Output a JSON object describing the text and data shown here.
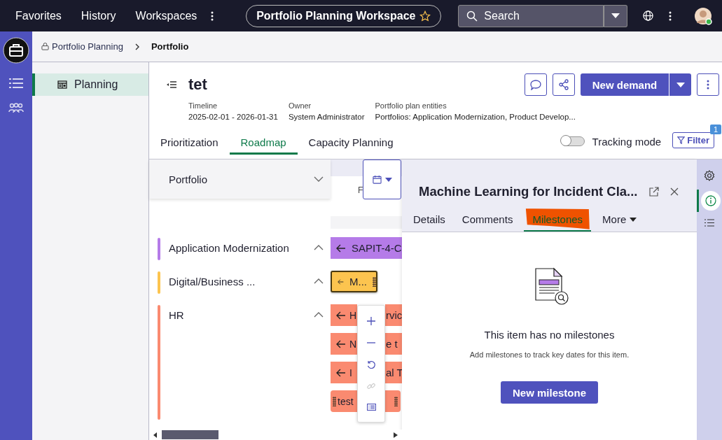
{
  "top_nav": {
    "links": [
      "Favorites",
      "History",
      "Workspaces"
    ],
    "workspace": "Portfolio Planning Workspace",
    "search": {
      "placeholder": "Search"
    }
  },
  "breadcrumb": [
    {
      "label": "Portfolio Planning",
      "kind": "link"
    },
    {
      "label": "Portfolio",
      "kind": "current"
    }
  ],
  "sidebar": {
    "items": [
      {
        "label": "Planning",
        "selected": true
      }
    ]
  },
  "header": {
    "title": "tet",
    "fields": [
      {
        "label": "Timeline",
        "value": "2025-02-01 - 2026-01-31"
      },
      {
        "label": "Owner",
        "value": "System Administrator"
      },
      {
        "label": "Portfolio plan entities",
        "value": "Portfolios: Application Modernization, Product Develop..."
      }
    ],
    "primary_button": "New demand"
  },
  "tabs": [
    {
      "label": "Prioritization",
      "selected": false
    },
    {
      "label": "Roadmap",
      "selected": true
    },
    {
      "label": "Capacity Planning",
      "selected": false
    }
  ],
  "tracking_mode": {
    "label": "Tracking mode",
    "on": false
  },
  "filter": {
    "label": "Filter",
    "badge": "1"
  },
  "portfolio_panel": {
    "title": "Portfolio",
    "groups": [
      {
        "name": "Application Modernization",
        "color": "#b57be8",
        "expanded": true,
        "bars": [
          {
            "kind": "arrow",
            "label": "SAPIT-4-C",
            "selected": false
          }
        ]
      },
      {
        "name": "Digital/Business ...",
        "color": "#fcc44f",
        "expanded": true,
        "bars": [
          {
            "kind": "arrow",
            "label": "M...",
            "selected": true
          }
        ]
      },
      {
        "name": "HR",
        "color": "#fa8a70",
        "expanded": true,
        "bars": [
          {
            "kind": "arrow",
            "label": "H",
            "label_after": "rvic",
            "selected": false
          },
          {
            "kind": "arrow",
            "label": "N",
            "label_after": "e t",
            "selected": false
          },
          {
            "kind": "arrow",
            "label": "I",
            "label_after": "al T",
            "selected": false
          },
          {
            "kind": "plain",
            "label": "test",
            "selected": false
          }
        ]
      }
    ]
  },
  "timeline_header": "F",
  "detail": {
    "title": "Machine Learning for Incident Cla...",
    "tabs": [
      {
        "label": "Details",
        "selected": false,
        "highlighted": false
      },
      {
        "label": "Comments",
        "selected": false,
        "highlighted": false
      },
      {
        "label": "Milestones",
        "selected": true,
        "highlighted": true
      }
    ],
    "more": "More",
    "empty_title": "This item has no milestones",
    "empty_text": "Add milestones to track key dates for this item.",
    "button": "New milestone"
  }
}
